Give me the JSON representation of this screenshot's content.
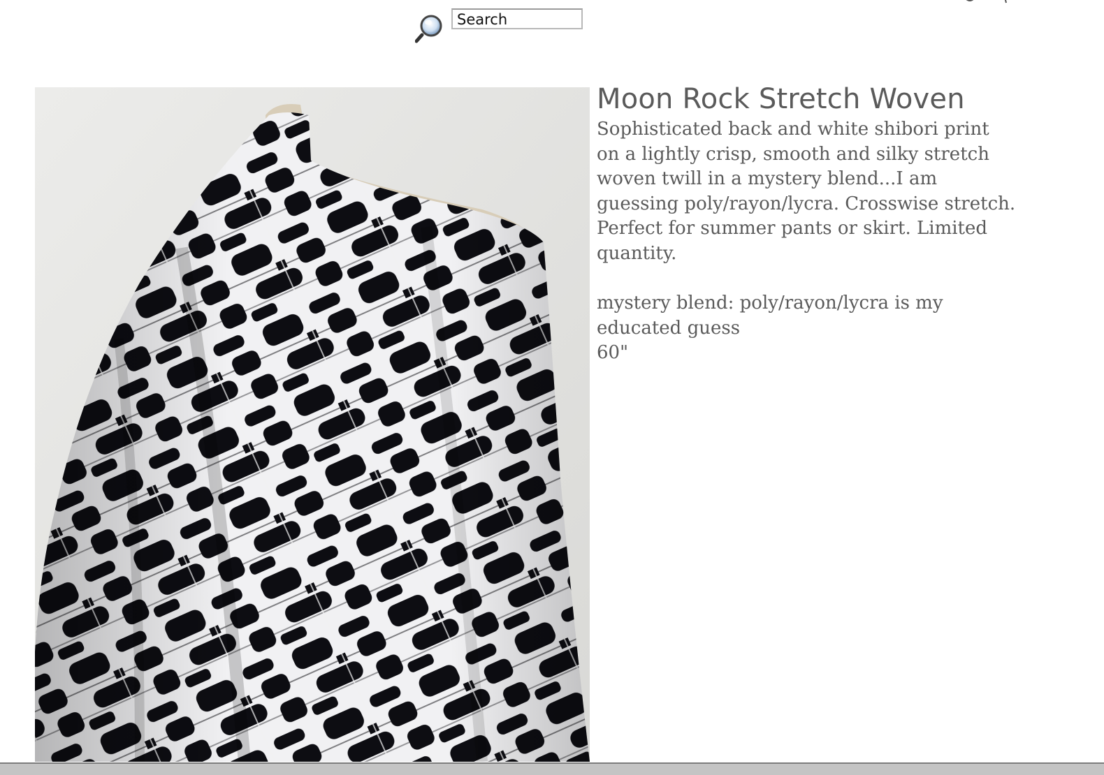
{
  "search": {
    "placeholder": "Search",
    "icon": "magnifying-glass-icon"
  },
  "product": {
    "title": "Moon Rock Stretch Woven",
    "description": "Sophisticated back and white shibori print on a lightly crisp, smooth and silky stretch woven twill in a mystery blend...I am guessing poly/rayon/lycra. Crosswise stretch. Perfect for summer pants or skirt. Limited quantity.",
    "specs": {
      "blend": "mystery blend: poly/rayon/lycra is my educated guess",
      "width": "60\""
    },
    "image": {
      "subject": "fabric-draped-on-dress-form",
      "colors": [
        "#0d0d12",
        "#f2f2f4",
        "#e6e6e3"
      ]
    }
  },
  "theme": {
    "text_color": "#5a5a5a",
    "background": "#ffffff",
    "scrollbar_color": "#c4c4c4"
  }
}
